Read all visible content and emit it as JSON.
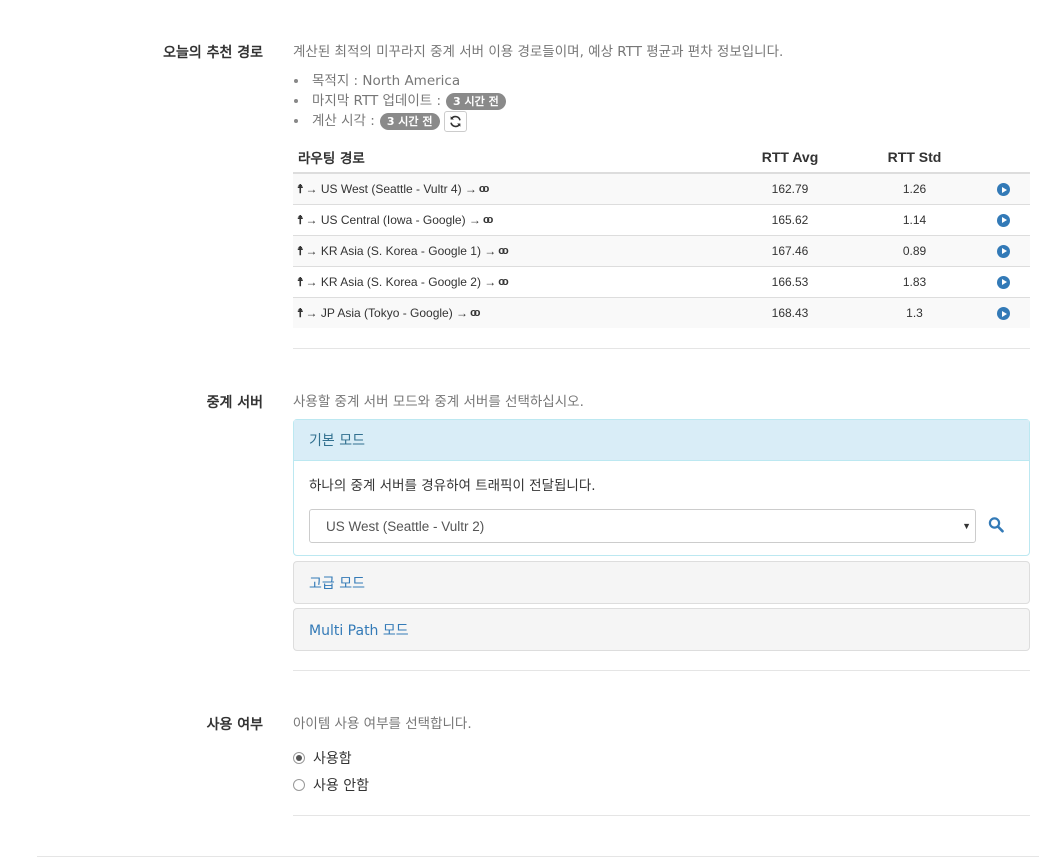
{
  "recommend": {
    "label": "오늘의 추천 경로",
    "help": "계산된 최적의 미꾸라지 중계 서버 이용 경로들이며, 예상 RTT 평균과 편차 정보입니다.",
    "destination_label": "목적지 : North America",
    "last_update_label": "마지막 RTT 업데이트 :",
    "last_update_badge": "3 시간 전",
    "calc_time_label": "계산 시각 :",
    "calc_time_badge": "3 시간 전",
    "table": {
      "headers": [
        "라우팅 경로",
        "RTT Avg",
        "RTT Std"
      ],
      "rows": [
        {
          "route": "→ US West (Seattle - Vultr 4) →",
          "avg": "162.79",
          "std": "1.26"
        },
        {
          "route": "→ US Central (Iowa - Google) →",
          "avg": "165.62",
          "std": "1.14"
        },
        {
          "route": "→ KR Asia (S. Korea - Google 1) →",
          "avg": "167.46",
          "std": "0.89"
        },
        {
          "route": "→ KR Asia (S. Korea - Google 2) →",
          "avg": "166.53",
          "std": "1.83"
        },
        {
          "route": "→ JP Asia (Tokyo - Google) →",
          "avg": "168.43",
          "std": "1.3"
        }
      ]
    }
  },
  "relay": {
    "label": "중계 서버",
    "help": "사용할 중계 서버 모드와 중계 서버를 선택하십시오.",
    "basic_mode": {
      "title": "기본 모드",
      "desc": "하나의 중계 서버를 경유하여 트래픽이 전달됩니다.",
      "selected_server": "US West (Seattle - Vultr 2)"
    },
    "advanced_mode": {
      "title": "고급 모드"
    },
    "multipath_mode": {
      "title": "Multi Path 모드"
    }
  },
  "usage": {
    "label": "사용 여부",
    "help": "아이템 사용 여부를 선택합니다.",
    "options": [
      {
        "label": "사용함",
        "checked": true
      },
      {
        "label": "사용 안함",
        "checked": false
      }
    ]
  },
  "colors": {
    "link": "#337ab7",
    "badge": "#8a8a8a",
    "active_panel_bg": "#d9edf7"
  },
  "icons": {
    "route_start": "person-icon",
    "route_end": "link-icon",
    "row_action": "play-circle-icon",
    "refresh": "refresh-icon",
    "search": "search-icon"
  }
}
